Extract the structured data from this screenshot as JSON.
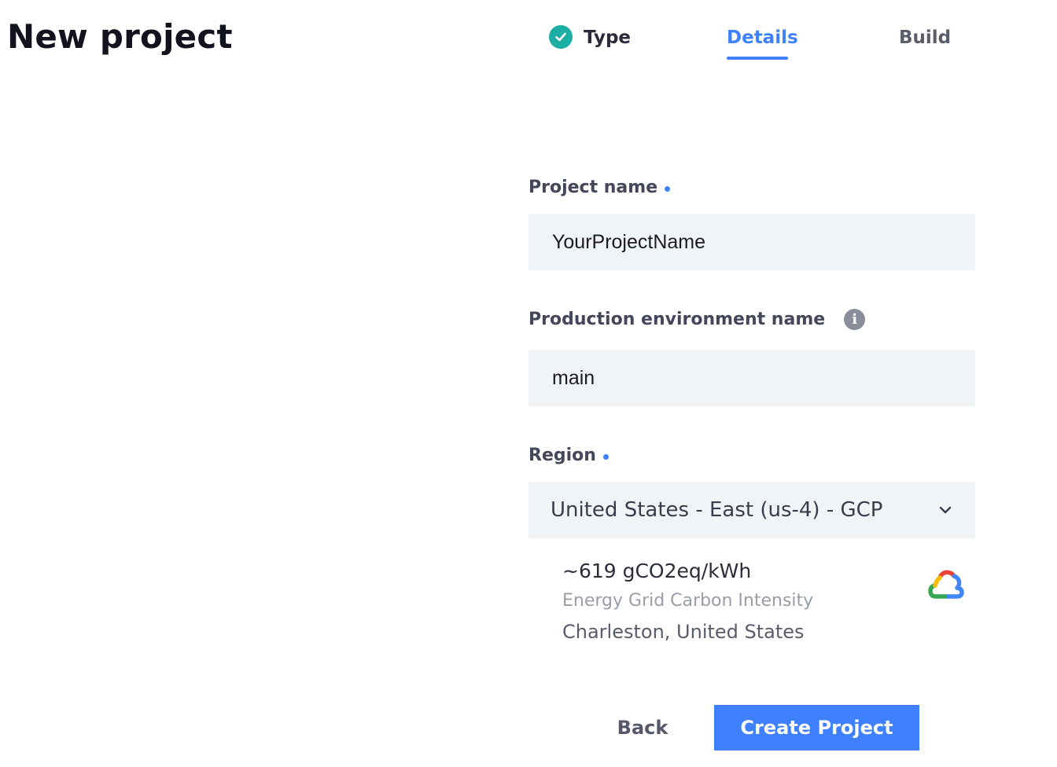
{
  "page": {
    "title": "New project"
  },
  "stepper": {
    "steps": [
      {
        "label": "Type",
        "state": "completed",
        "icon": "check-circle-icon"
      },
      {
        "label": "Details",
        "state": "active"
      },
      {
        "label": "Build",
        "state": "upcoming"
      }
    ]
  },
  "form": {
    "project_name": {
      "label": "Project name",
      "required": true,
      "value": "YourProjectName"
    },
    "production_environment": {
      "label": "Production environment name",
      "info_icon": "info-icon",
      "value": "main"
    },
    "region": {
      "label": "Region",
      "required": true,
      "selected": "United States - East (us-4) - GCP",
      "dropdown_icon": "chevron-down-icon",
      "carbon_intensity": "~619 gCO2eq/kWh",
      "carbon_caption": "Energy Grid Carbon Intensity",
      "location": "Charleston, United States",
      "provider_icon": "google-cloud-icon"
    }
  },
  "actions": {
    "back_label": "Back",
    "create_label": "Create Project"
  },
  "colors": {
    "accent": "#3f80ff",
    "success": "#1aaea5",
    "input_background": "#f1f4f7"
  }
}
